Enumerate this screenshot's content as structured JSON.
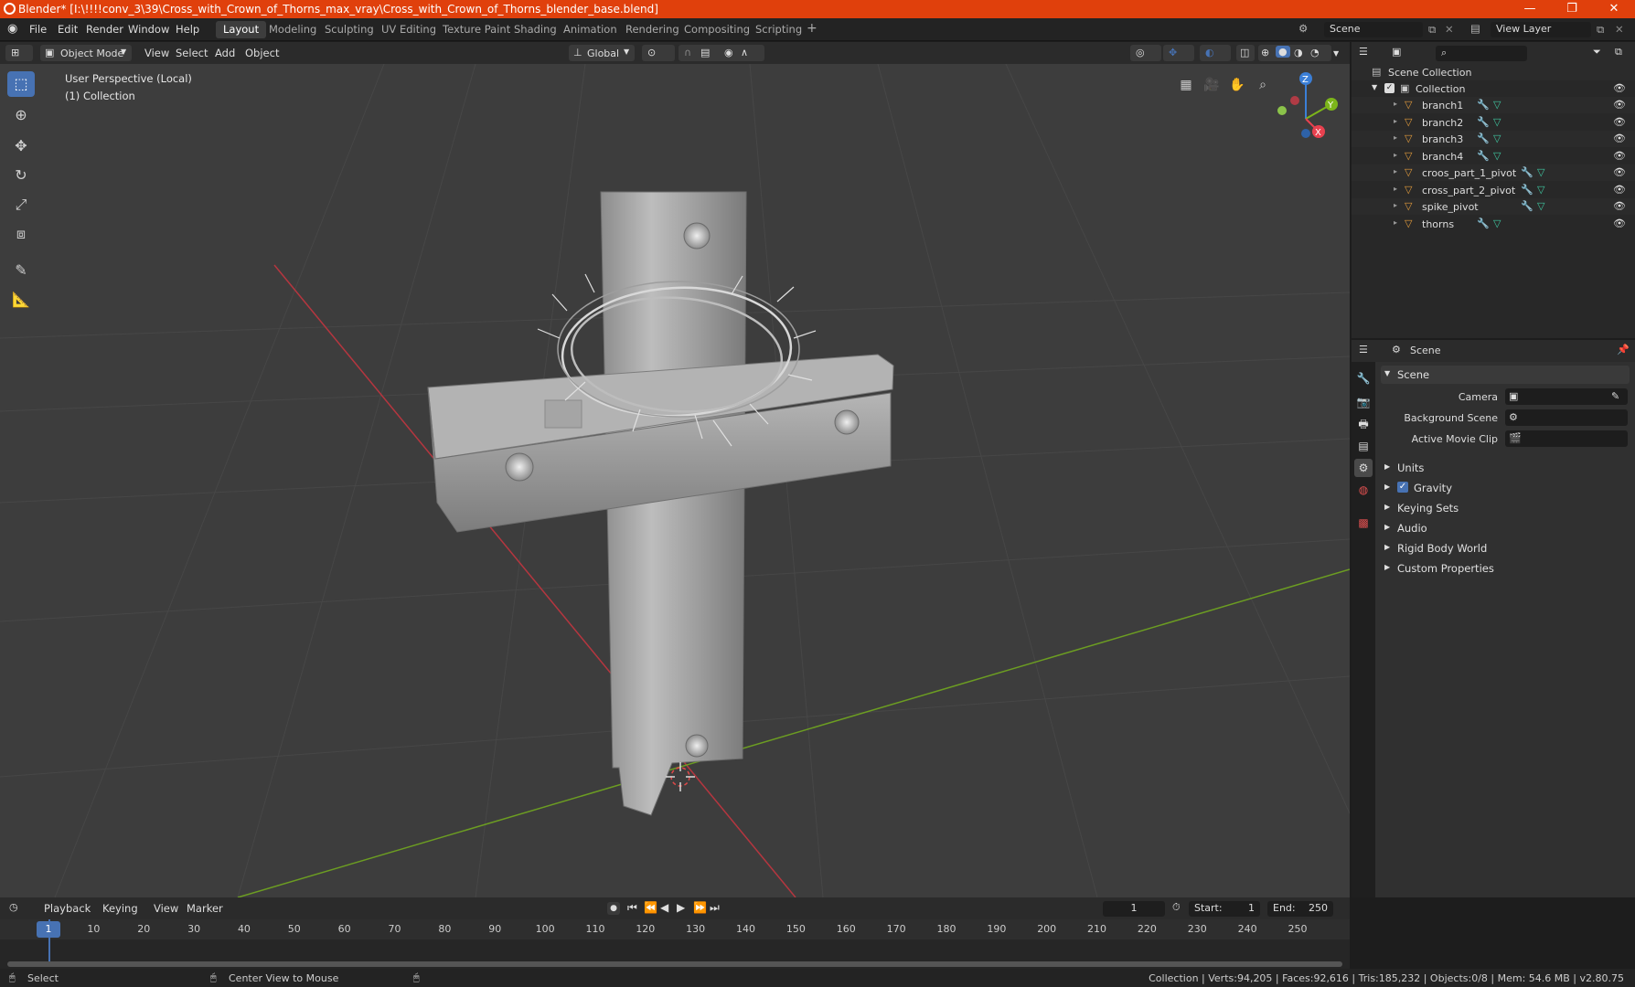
{
  "window": {
    "title": "Blender* [I:\\!!!!conv_3\\39\\Cross_with_Crown_of_Thorns_max_vray\\Cross_with_Crown_of_Thorns_blender_base.blend]",
    "controls": [
      "—",
      "❐",
      "✕"
    ]
  },
  "menu": {
    "items": [
      "File",
      "Edit",
      "Render",
      "Window",
      "Help"
    ],
    "workspaces": [
      "Layout",
      "Modeling",
      "Sculpting",
      "UV Editing",
      "Texture Paint",
      "Shading",
      "Animation",
      "Rendering",
      "Compositing",
      "Scripting"
    ],
    "active_workspace": "Layout",
    "add_tab": "+",
    "scene_label": "Scene",
    "view_layer_label": "View Layer"
  },
  "viewport_header": {
    "mode": "Object Mode",
    "menus": [
      "View",
      "Select",
      "Add",
      "Object"
    ],
    "transform_orientation": "Global"
  },
  "viewport": {
    "perspective": "User Perspective (Local)",
    "collection": "(1) Collection",
    "gizmo_axes": {
      "x": "X",
      "y": "Y",
      "z": "Z"
    },
    "accent_color": "#4772b3",
    "axis_x_color": "#e8414f",
    "axis_y_color": "#7cb51a",
    "axis_z_color": "#3b7fd7",
    "object_color": "#a8a8a8"
  },
  "outliner": {
    "scene_collection": "Scene Collection",
    "collection": "Collection",
    "objects": [
      "branch1",
      "branch2",
      "branch3",
      "branch4",
      "croos_part_1_pivot",
      "cross_part_2_pivot",
      "spike_pivot",
      "thorns"
    ],
    "object_icon_color": "#e09a3c",
    "modifier_icon_color": "#6aa8f0",
    "mesh_icon_color": "#3fc7a0"
  },
  "properties": {
    "header": "Scene",
    "section": "Scene",
    "fields": [
      {
        "label": "Camera"
      },
      {
        "label": "Background Scene"
      },
      {
        "label": "Active Movie Clip"
      }
    ],
    "collapsed": [
      "Units",
      "Gravity",
      "Keying Sets",
      "Audio",
      "Rigid Body World",
      "Custom Properties"
    ],
    "gravity_checked": true
  },
  "timeline": {
    "menus": [
      "Playback",
      "Keying",
      "View",
      "Marker"
    ],
    "current_frame": "1",
    "start_label": "Start:",
    "start": "1",
    "end_label": "End:",
    "end": "250",
    "ticks": [
      "1",
      "10",
      "20",
      "30",
      "40",
      "50",
      "60",
      "70",
      "80",
      "90",
      "100",
      "110",
      "120",
      "130",
      "140",
      "150",
      "160",
      "170",
      "180",
      "190",
      "200",
      "210",
      "220",
      "230",
      "240",
      "250"
    ]
  },
  "statusbar": {
    "left": "Select",
    "middle": "Center View to Mouse",
    "stats": "Collection | Verts:94,205 | Faces:92,616 | Tris:185,232 | Objects:0/8 | Mem: 54.6 MB | v2.80.75"
  }
}
